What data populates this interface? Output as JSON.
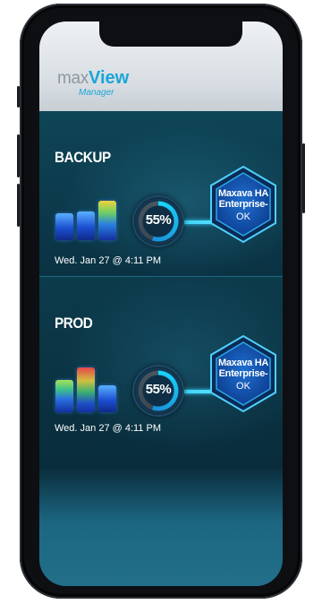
{
  "header": {
    "logo_max": "max",
    "logo_view": "View",
    "logo_manager": "Manager"
  },
  "sections": [
    {
      "title": "BACKUP",
      "gauge_percent": 55,
      "gauge_label": "55%",
      "hex_title_line1": "Maxava HA",
      "hex_title_line2": "Enterprise-",
      "hex_status": "OK",
      "timestamp": "Wed. Jan 27 @ 4:11 PM",
      "bar_colors": [
        "blue",
        "blue",
        "blue-green"
      ]
    },
    {
      "title": "PROD",
      "gauge_percent": 55,
      "gauge_label": "55%",
      "hex_title_line1": "Maxava HA",
      "hex_title_line2": "Enterprise-",
      "hex_status": "OK",
      "timestamp": "Wed. Jan 27 @ 4:11 PM",
      "bar_colors": [
        "blue-green",
        "red-green",
        "blue"
      ]
    }
  ],
  "colors": {
    "accent": "#1aa6d6",
    "panel": "#0e4556",
    "link": "#2ec9f2"
  }
}
